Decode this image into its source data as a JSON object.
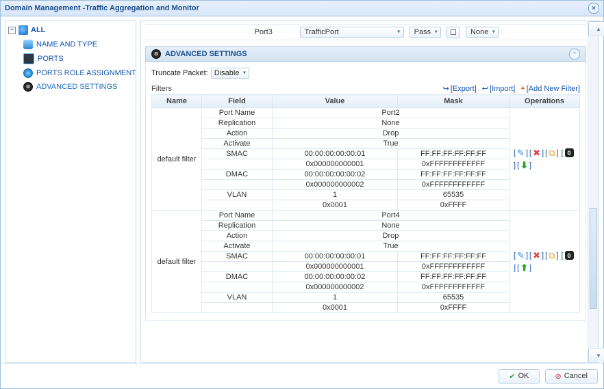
{
  "title": "Domain Management -Traffic Aggregation and Monitor",
  "sidebar": {
    "root": "ALL",
    "items": [
      {
        "label": "NAME AND TYPE"
      },
      {
        "label": "PORTS"
      },
      {
        "label": "PORTS ROLE ASSIGNMENTS"
      },
      {
        "label": "ADVANCED SETTINGS"
      }
    ]
  },
  "peekRow": {
    "col0": "Port3",
    "drop1": "TrafficPort",
    "drop2": "Pass",
    "drop3": "None"
  },
  "advanced": {
    "title": "ADVANCED SETTINGS",
    "truncateLabel": "Truncate Packet:",
    "truncateValue": "Disable",
    "filtersTitle": "Filters",
    "actions": {
      "export": "[Export]",
      "import": "[Import]",
      "add": "[Add New Filter]"
    },
    "columns": {
      "name": "Name",
      "field": "Field",
      "value": "Value",
      "mask": "Mask",
      "ops": "Operations"
    }
  },
  "filters": [
    {
      "name": "default filter",
      "move": "down",
      "rows": [
        {
          "field": "Port Name",
          "value": "Port2",
          "mask": ""
        },
        {
          "field": "Replication",
          "value": "None",
          "none": true,
          "mask": ""
        },
        {
          "field": "Action",
          "value": "Drop",
          "mask": ""
        },
        {
          "field": "Activate",
          "value": "True",
          "mask": ""
        },
        {
          "field": "SMAC",
          "value": "00:00:00:00:00:01",
          "mask": "FF:FF:FF:FF:FF:FF"
        },
        {
          "field": "",
          "value": "0x000000000001",
          "mask": "0xFFFFFFFFFFFF"
        },
        {
          "field": "DMAC",
          "value": "00:00:00:00:00:02",
          "mask": "FF:FF:FF:FF:FF:FF"
        },
        {
          "field": "",
          "value": "0x000000000002",
          "mask": "0xFFFFFFFFFFFF"
        },
        {
          "field": "VLAN",
          "value": "1",
          "mask": "65535"
        },
        {
          "field": "",
          "value": "0x0001",
          "mask": "0xFFFF"
        }
      ]
    },
    {
      "name": "default filter",
      "move": "up",
      "rows": [
        {
          "field": "Port Name",
          "value": "Port4",
          "mask": ""
        },
        {
          "field": "Replication",
          "value": "None",
          "none": true,
          "mask": ""
        },
        {
          "field": "Action",
          "value": "Drop",
          "mask": ""
        },
        {
          "field": "Activate",
          "value": "True",
          "mask": ""
        },
        {
          "field": "SMAC",
          "value": "00:00:00:00:00:01",
          "mask": "FF:FF:FF:FF:FF:FF"
        },
        {
          "field": "",
          "value": "0x000000000001",
          "mask": "0xFFFFFFFFFFFF"
        },
        {
          "field": "DMAC",
          "value": "00:00:00:00:00:02",
          "mask": "FF:FF:FF:FF:FF:FF"
        },
        {
          "field": "",
          "value": "0x000000000002",
          "mask": "0xFFFFFFFFFFFF"
        },
        {
          "field": "VLAN",
          "value": "1",
          "mask": "65535"
        },
        {
          "field": "",
          "value": "0x0001",
          "mask": "0xFFFF"
        }
      ]
    }
  ],
  "buttons": {
    "ok": "OK",
    "cancel": "Cancel"
  }
}
